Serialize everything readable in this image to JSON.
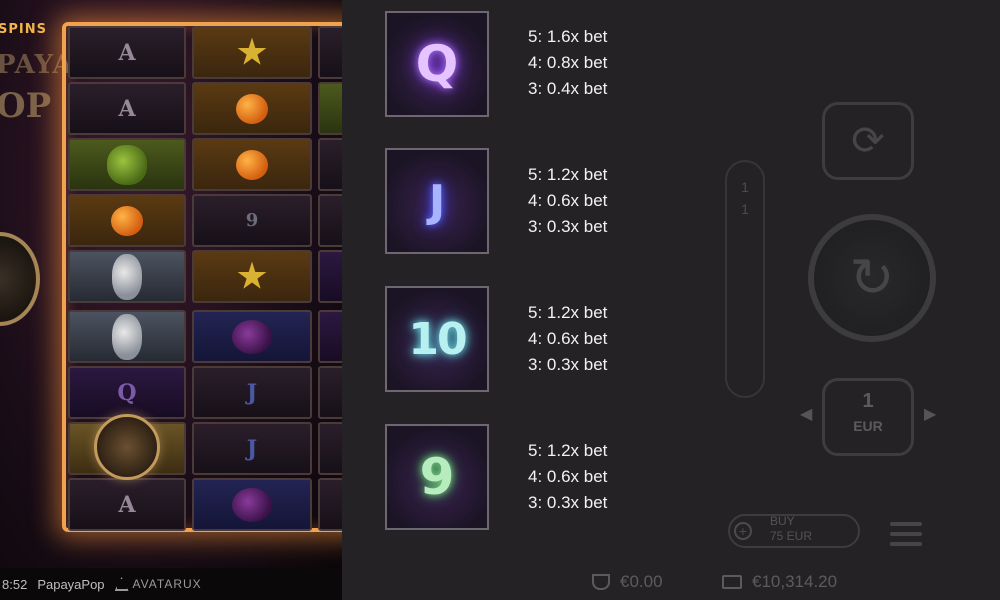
{
  "game": {
    "logo_top": "SPINS",
    "logo_mid": "PAYA",
    "logo_bot": "OP",
    "reels": {
      "col1": [
        "A",
        "A",
        "durian",
        "papaya",
        "pineapple",
        "pineapple",
        "Q",
        "wild",
        "A"
      ],
      "col2": [
        "star",
        "papaya",
        "papaya",
        "9",
        "star",
        "fig",
        "J",
        "J",
        "fig"
      ]
    }
  },
  "bottom_bar": {
    "time": "8:52",
    "game_name": "PapayaPop",
    "provider": "AVATARUX"
  },
  "paytable": {
    "symbols": [
      {
        "icon": "Q",
        "name": "symbol-q",
        "pays": [
          "5: 1.6x bet",
          "4: 0.8x bet",
          "3: 0.4x bet"
        ]
      },
      {
        "icon": "J",
        "name": "symbol-j",
        "pays": [
          "5: 1.2x bet",
          "4: 0.6x bet",
          "3: 0.3x bet"
        ]
      },
      {
        "icon": "10",
        "name": "symbol-10",
        "pays": [
          "5: 1.2x bet",
          "4: 0.6x bet",
          "3: 0.3x bet"
        ]
      },
      {
        "icon": "9",
        "name": "symbol-9",
        "pays": [
          "5: 1.2x bet",
          "4: 0.6x bet",
          "3: 0.3x bet"
        ]
      }
    ]
  },
  "controls": {
    "bet_value": "1",
    "bet_currency": "EUR",
    "buy_label_line1": "BUY",
    "buy_label_line2": "75 EUR",
    "paylines": [
      "1",
      "1",
      "",
      "",
      "",
      ""
    ],
    "win": "€0.00",
    "balance": "€10,314.20"
  },
  "colors": {
    "overlay": "#262426",
    "frame_glow": "#f0a24f",
    "text": "#f2f2f2"
  }
}
